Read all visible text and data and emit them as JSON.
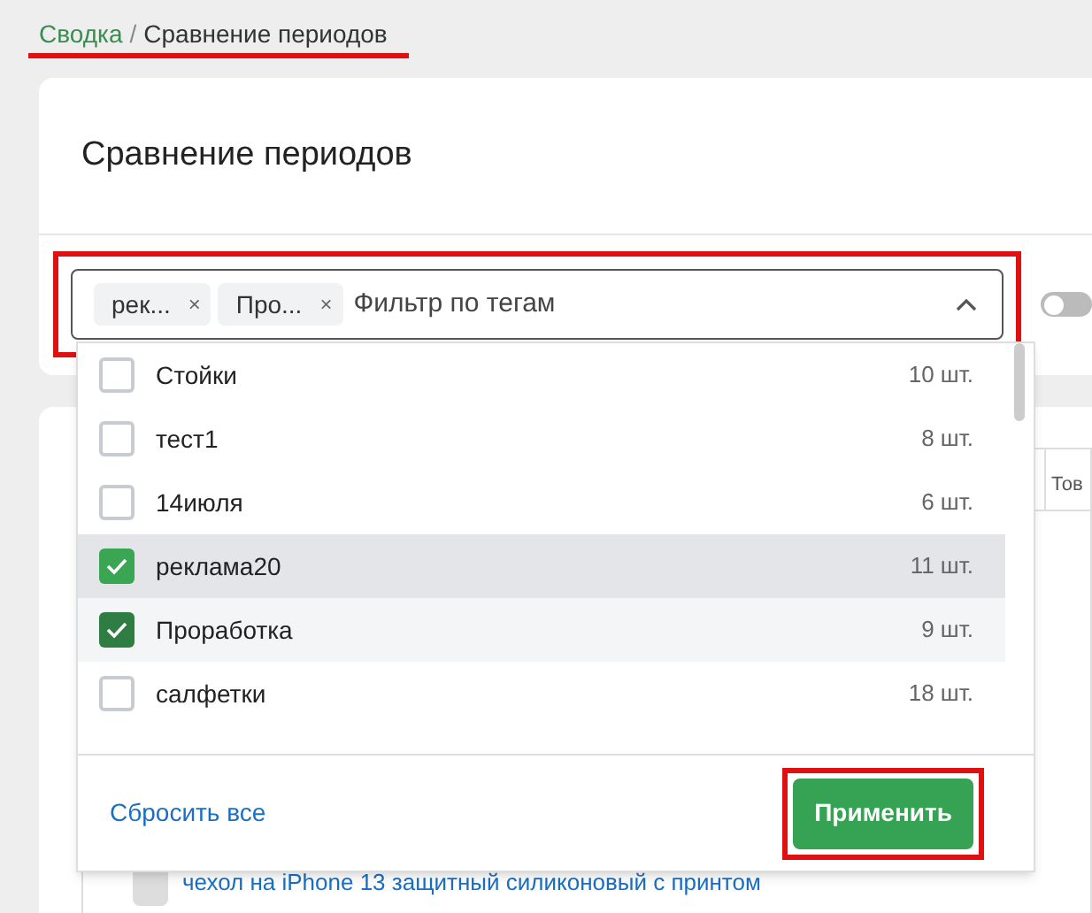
{
  "breadcrumb": [
    {
      "label": "Сводка",
      "kind": "link"
    },
    {
      "label": "Сравнение периодов",
      "kind": "current"
    }
  ],
  "toggle": {
    "on": false
  },
  "breadcrumb_separator": "/",
  "title": "Сравнение периодов",
  "tag_filter": {
    "placeholder": "Фильтр по тегам",
    "chips": [
      "рек...",
      "Про..."
    ],
    "chip_remove": "×",
    "expanded": true
  },
  "options": [
    {
      "label": "Стойки",
      "count": "10 шт.",
      "checked": false,
      "selected": false
    },
    {
      "label": "тест1",
      "count": "8 шт.",
      "checked": false,
      "selected": false
    },
    {
      "label": "14июля",
      "count": "6 шт.",
      "checked": false,
      "selected": false
    },
    {
      "label": "реклама20",
      "count": "11 шт.",
      "checked": true,
      "selected": true
    },
    {
      "label": "Проработка",
      "count": "9 шт.",
      "checked": true,
      "selected": false
    },
    {
      "label": "салфетки",
      "count": "18 шт.",
      "checked": false,
      "selected": false
    }
  ],
  "reset_link": "Сбросить все",
  "apply_button": "Применить",
  "table": {
    "column_header": "Тов",
    "row_link": "чехол на iPhone 13 защитный силиконовый с принтом"
  }
}
